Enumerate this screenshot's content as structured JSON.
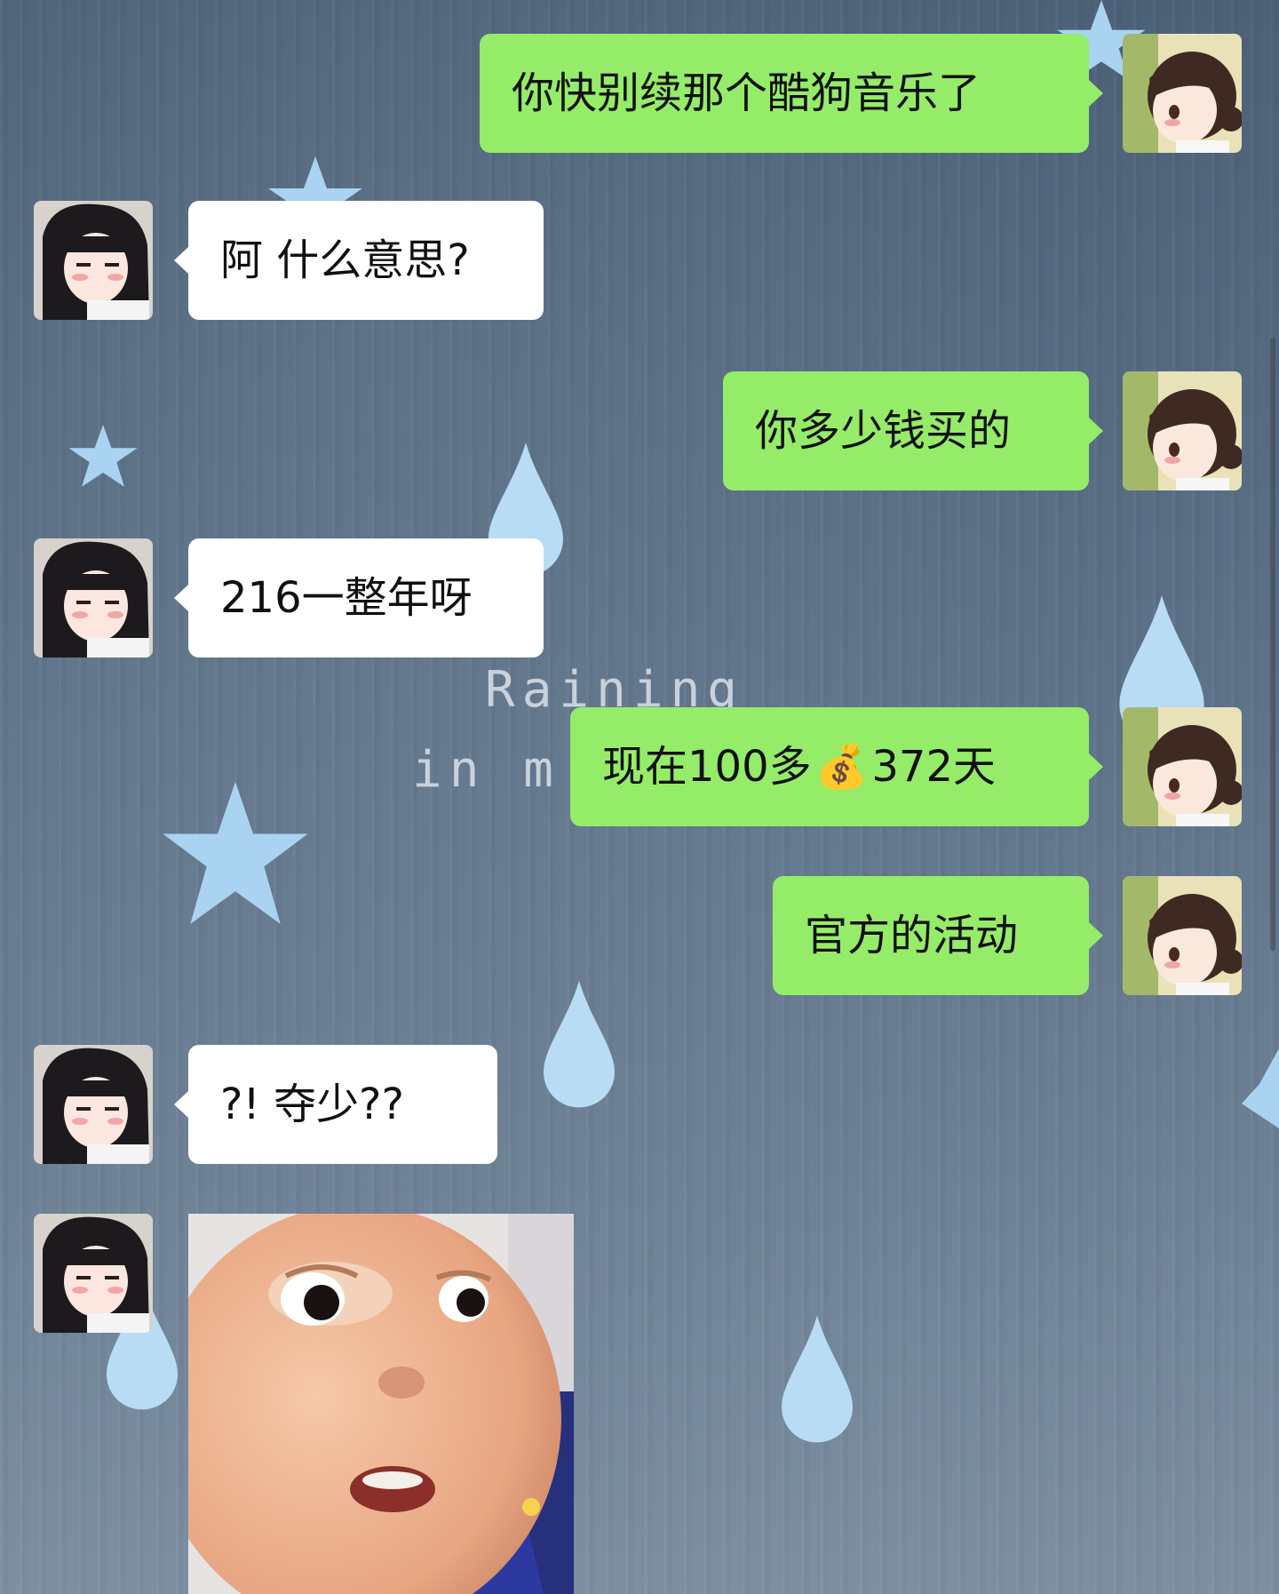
{
  "chat": {
    "messages": [
      {
        "side": "out",
        "text": "你快别续那个酷狗音乐了"
      },
      {
        "side": "in",
        "text": "阿 什么意思?"
      },
      {
        "side": "out",
        "text": "你多少钱买的"
      },
      {
        "side": "in",
        "text": "216一整年呀"
      },
      {
        "side": "out",
        "text_before": "现在100多",
        "emoji": "💰",
        "text_after": "372天"
      },
      {
        "side": "out",
        "text": "官方的活动"
      },
      {
        "side": "in",
        "text": "?! 夺少??"
      },
      {
        "side": "in",
        "type": "sticker",
        "sticker": "surprised-baby-sticker"
      }
    ]
  },
  "background": {
    "watermark_line1": "Raining",
    "watermark_line2": "in m",
    "base_color": "#5a6f86",
    "star_color": "#a9d3f0",
    "drop_color": "#b7dcf4"
  },
  "colors": {
    "incoming_bubble": "#ffffff",
    "outgoing_bubble": "#95ec69",
    "text": "#111111"
  },
  "icons": {
    "self_avatar": "anime-girl-brown-hair-avatar",
    "friend_avatar": "anime-girl-black-hair-avatar"
  }
}
